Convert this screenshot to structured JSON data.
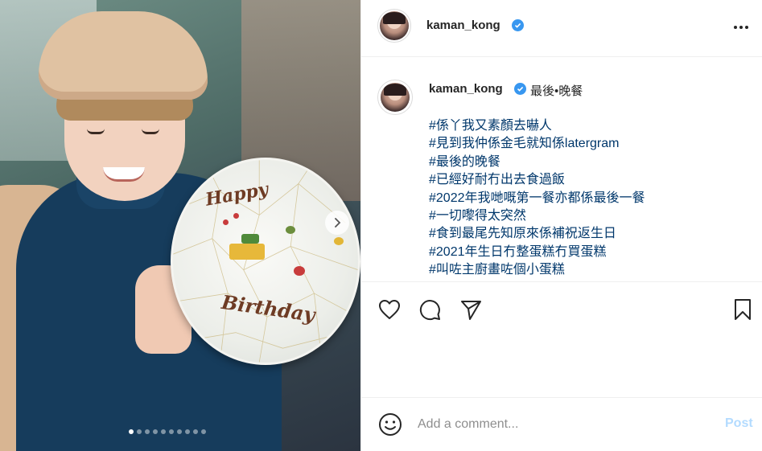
{
  "post": {
    "username": "kaman_kong",
    "verified": true,
    "more_icon": "more-options-icon"
  },
  "caption": {
    "username": "kaman_kong",
    "text": "最後•晚餐",
    "hashtags": [
      "#係丫我又素顏去嚇人",
      "#見到我仲係金毛就知係latergram",
      "#最後的晚餐",
      "#已經好耐冇出去食過飯",
      "#2022年我哋嘅第一餐亦都係最後一餐",
      "#一切嚟得太突然",
      "#食到最尾先知原來係補祝返生日",
      "#2021年生日冇整蛋糕冇買蛋糕",
      "#叫咗主廚畫咗個小蛋糕"
    ]
  },
  "media": {
    "carousel_total": 10,
    "carousel_active": 1,
    "next_icon": "chevron-right-icon"
  },
  "actions": {
    "like_icon": "heart-icon",
    "comment_icon": "comment-icon",
    "share_icon": "paper-plane-icon",
    "save_icon": "bookmark-icon"
  },
  "comment": {
    "placeholder": "Add a comment...",
    "post_label": "Post",
    "emoji_icon": "smiley-icon"
  },
  "colors": {
    "verified": "#3897f0",
    "hashtag": "#00376b",
    "post_disabled": "#b3dbff",
    "border": "#efefef"
  }
}
